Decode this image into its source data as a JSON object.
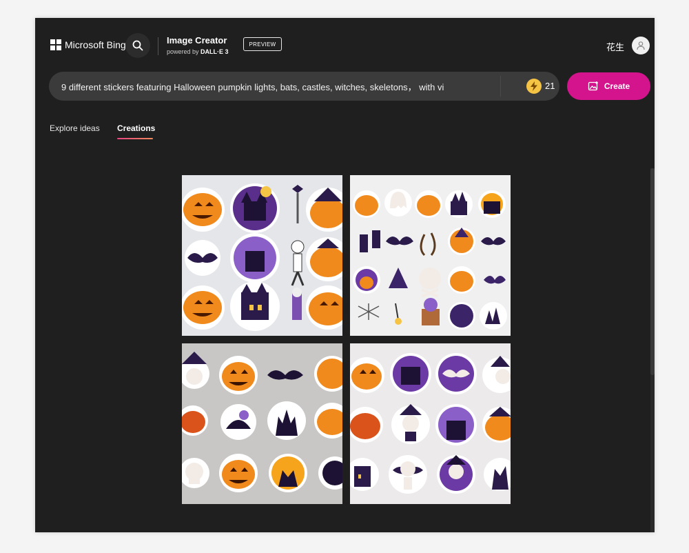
{
  "header": {
    "brand": "Microsoft Bing",
    "app_title": "Image Creator",
    "powered_prefix": "powered by",
    "powered_model": "DALL·E 3",
    "preview_badge": "PREVIEW",
    "user_name": "花生"
  },
  "prompt": {
    "value": "9 different stickers featuring Halloween pumpkin lights, bats, castles, witches, skeletons， with vi",
    "boost_count": "21",
    "create_label": "Create"
  },
  "tabs": [
    {
      "label": "Explore ideas",
      "active": false
    },
    {
      "label": "Creations",
      "active": true
    }
  ],
  "images": [
    {
      "background": "#e4e6ea",
      "alt_icon": "halloween-sticker-sheet"
    },
    {
      "background": "#f0f0f0",
      "alt_icon": "halloween-sticker-sheet"
    },
    {
      "background": "#c9c7c5",
      "alt_icon": "halloween-sticker-sheet"
    },
    {
      "background": "#eceaea",
      "alt_icon": "halloween-sticker-sheet"
    }
  ],
  "colors": {
    "page_bg": "#1f1f1f",
    "accent": "#d3148d",
    "prompt_bg": "#3b3b3b",
    "pumpkin": "#f08a1c",
    "purple": "#6b3aa5"
  }
}
